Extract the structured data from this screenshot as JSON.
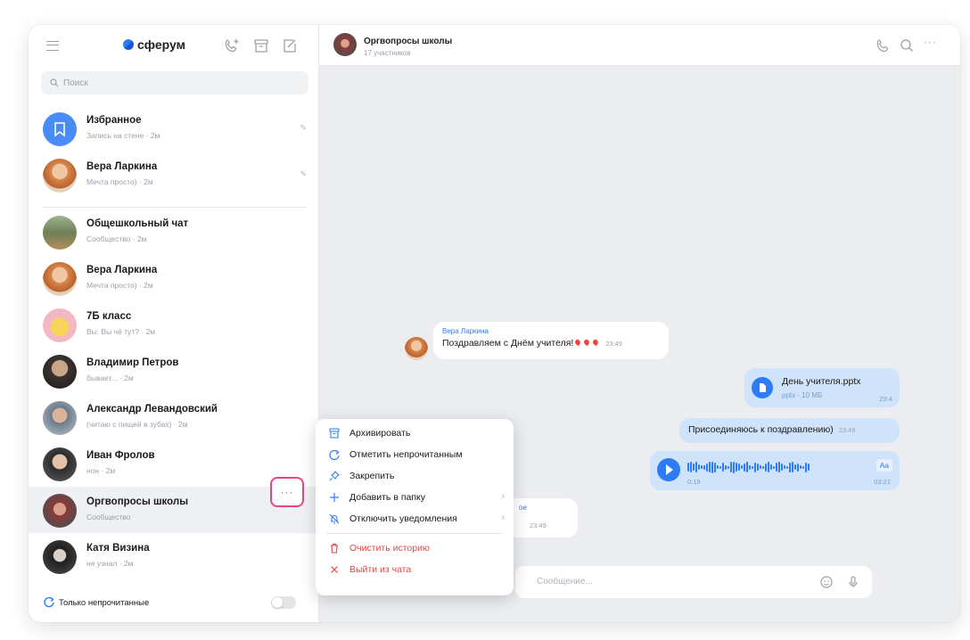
{
  "app": {
    "logo_text": "сферум"
  },
  "search": {
    "placeholder": "Поиск"
  },
  "chats": [
    {
      "title": "Избранное",
      "subtitle": "Запись на стене · 2м"
    },
    {
      "title": "Вера Ларкина",
      "subtitle": "Мечта просто) · 2м"
    },
    {
      "title": "Общешкольный чат",
      "subtitle": "Сообщество · 2м"
    },
    {
      "title": "Вера Ларкина",
      "subtitle": "Мечта просто) · 2м"
    },
    {
      "title": "7Б класс",
      "subtitle": "Вы: Вы чё тут? · 2м"
    },
    {
      "title": "Владимир Петров",
      "subtitle": "бывает... · 2м"
    },
    {
      "title": "Александр Левандовский",
      "subtitle": "(читаю с пищей в зубах) · 2м"
    },
    {
      "title": "Иван Фролов",
      "subtitle": "нон · 2м"
    },
    {
      "title": "Оргвопросы школы",
      "subtitle": "Сообщество"
    },
    {
      "title": "Катя Визина",
      "subtitle": "не узнал · 2м"
    }
  ],
  "footer": {
    "unread_only_label": "Только непрочитанные"
  },
  "conversation": {
    "title": "Оргвопросы школы",
    "subtitle": "17 участников"
  },
  "messages": {
    "greeting_sender": "Вера Ларкина",
    "greeting_text": "Поздравляем с Днём учителя!",
    "greeting_emoji": "🎈🎈🎈",
    "greeting_time": "23:49",
    "file_name": "День учителя.pptx",
    "file_meta": "pptx · 10 МБ",
    "file_time": "23:4",
    "join_text": "Присоединяюсь к поздравлению)",
    "join_time": "23:49",
    "voice_duration": "0:19",
    "voice_time": "03:21",
    "voice_aa": "Aa",
    "partial_text": "ое",
    "partial_time": "23:49"
  },
  "composer": {
    "placeholder": "Сообщение..."
  },
  "context_menu": {
    "items": [
      {
        "label": "Архивировать"
      },
      {
        "label": "Отметить непрочитанным"
      },
      {
        "label": "Закрепить"
      },
      {
        "label": "Добавить в папку"
      },
      {
        "label": "Отключить уведомления"
      },
      {
        "label": "Очистить историю"
      },
      {
        "label": "Выйти из чата"
      }
    ]
  },
  "colors": {
    "accent": "#2d7cf6",
    "danger": "#e64646",
    "highlight": "#e8467c"
  }
}
